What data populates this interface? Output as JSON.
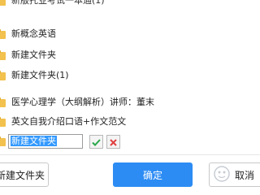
{
  "folders": [
    {
      "label": "新版托业考试一本通(1)",
      "icon": "folder-icon"
    },
    {
      "label": "新概念英语",
      "icon": "folder-icon"
    },
    {
      "label": "新建文件夹",
      "icon": "folder-icon"
    },
    {
      "label": "新建文件夹(1)",
      "icon": "folder-icon"
    },
    {
      "label": "医学心理学（大纲解析）讲师：董末",
      "icon": "folder-icon"
    },
    {
      "label": "英文自我介绍口语+作文范文",
      "icon": "folder-icon"
    }
  ],
  "rename": {
    "value": "新建文件夹",
    "confirm_icon": "check-icon",
    "cancel_icon": "close-icon"
  },
  "footer": {
    "new_folder_label": "新建文件夹",
    "confirm_label": "确定",
    "cancel_label": "取消"
  },
  "colors": {
    "accent": "#2c8cf4",
    "folder": "#f2c14e",
    "ok_green": "#2aa84a",
    "cancel_red": "#e04040",
    "selection": "#3399ff"
  }
}
